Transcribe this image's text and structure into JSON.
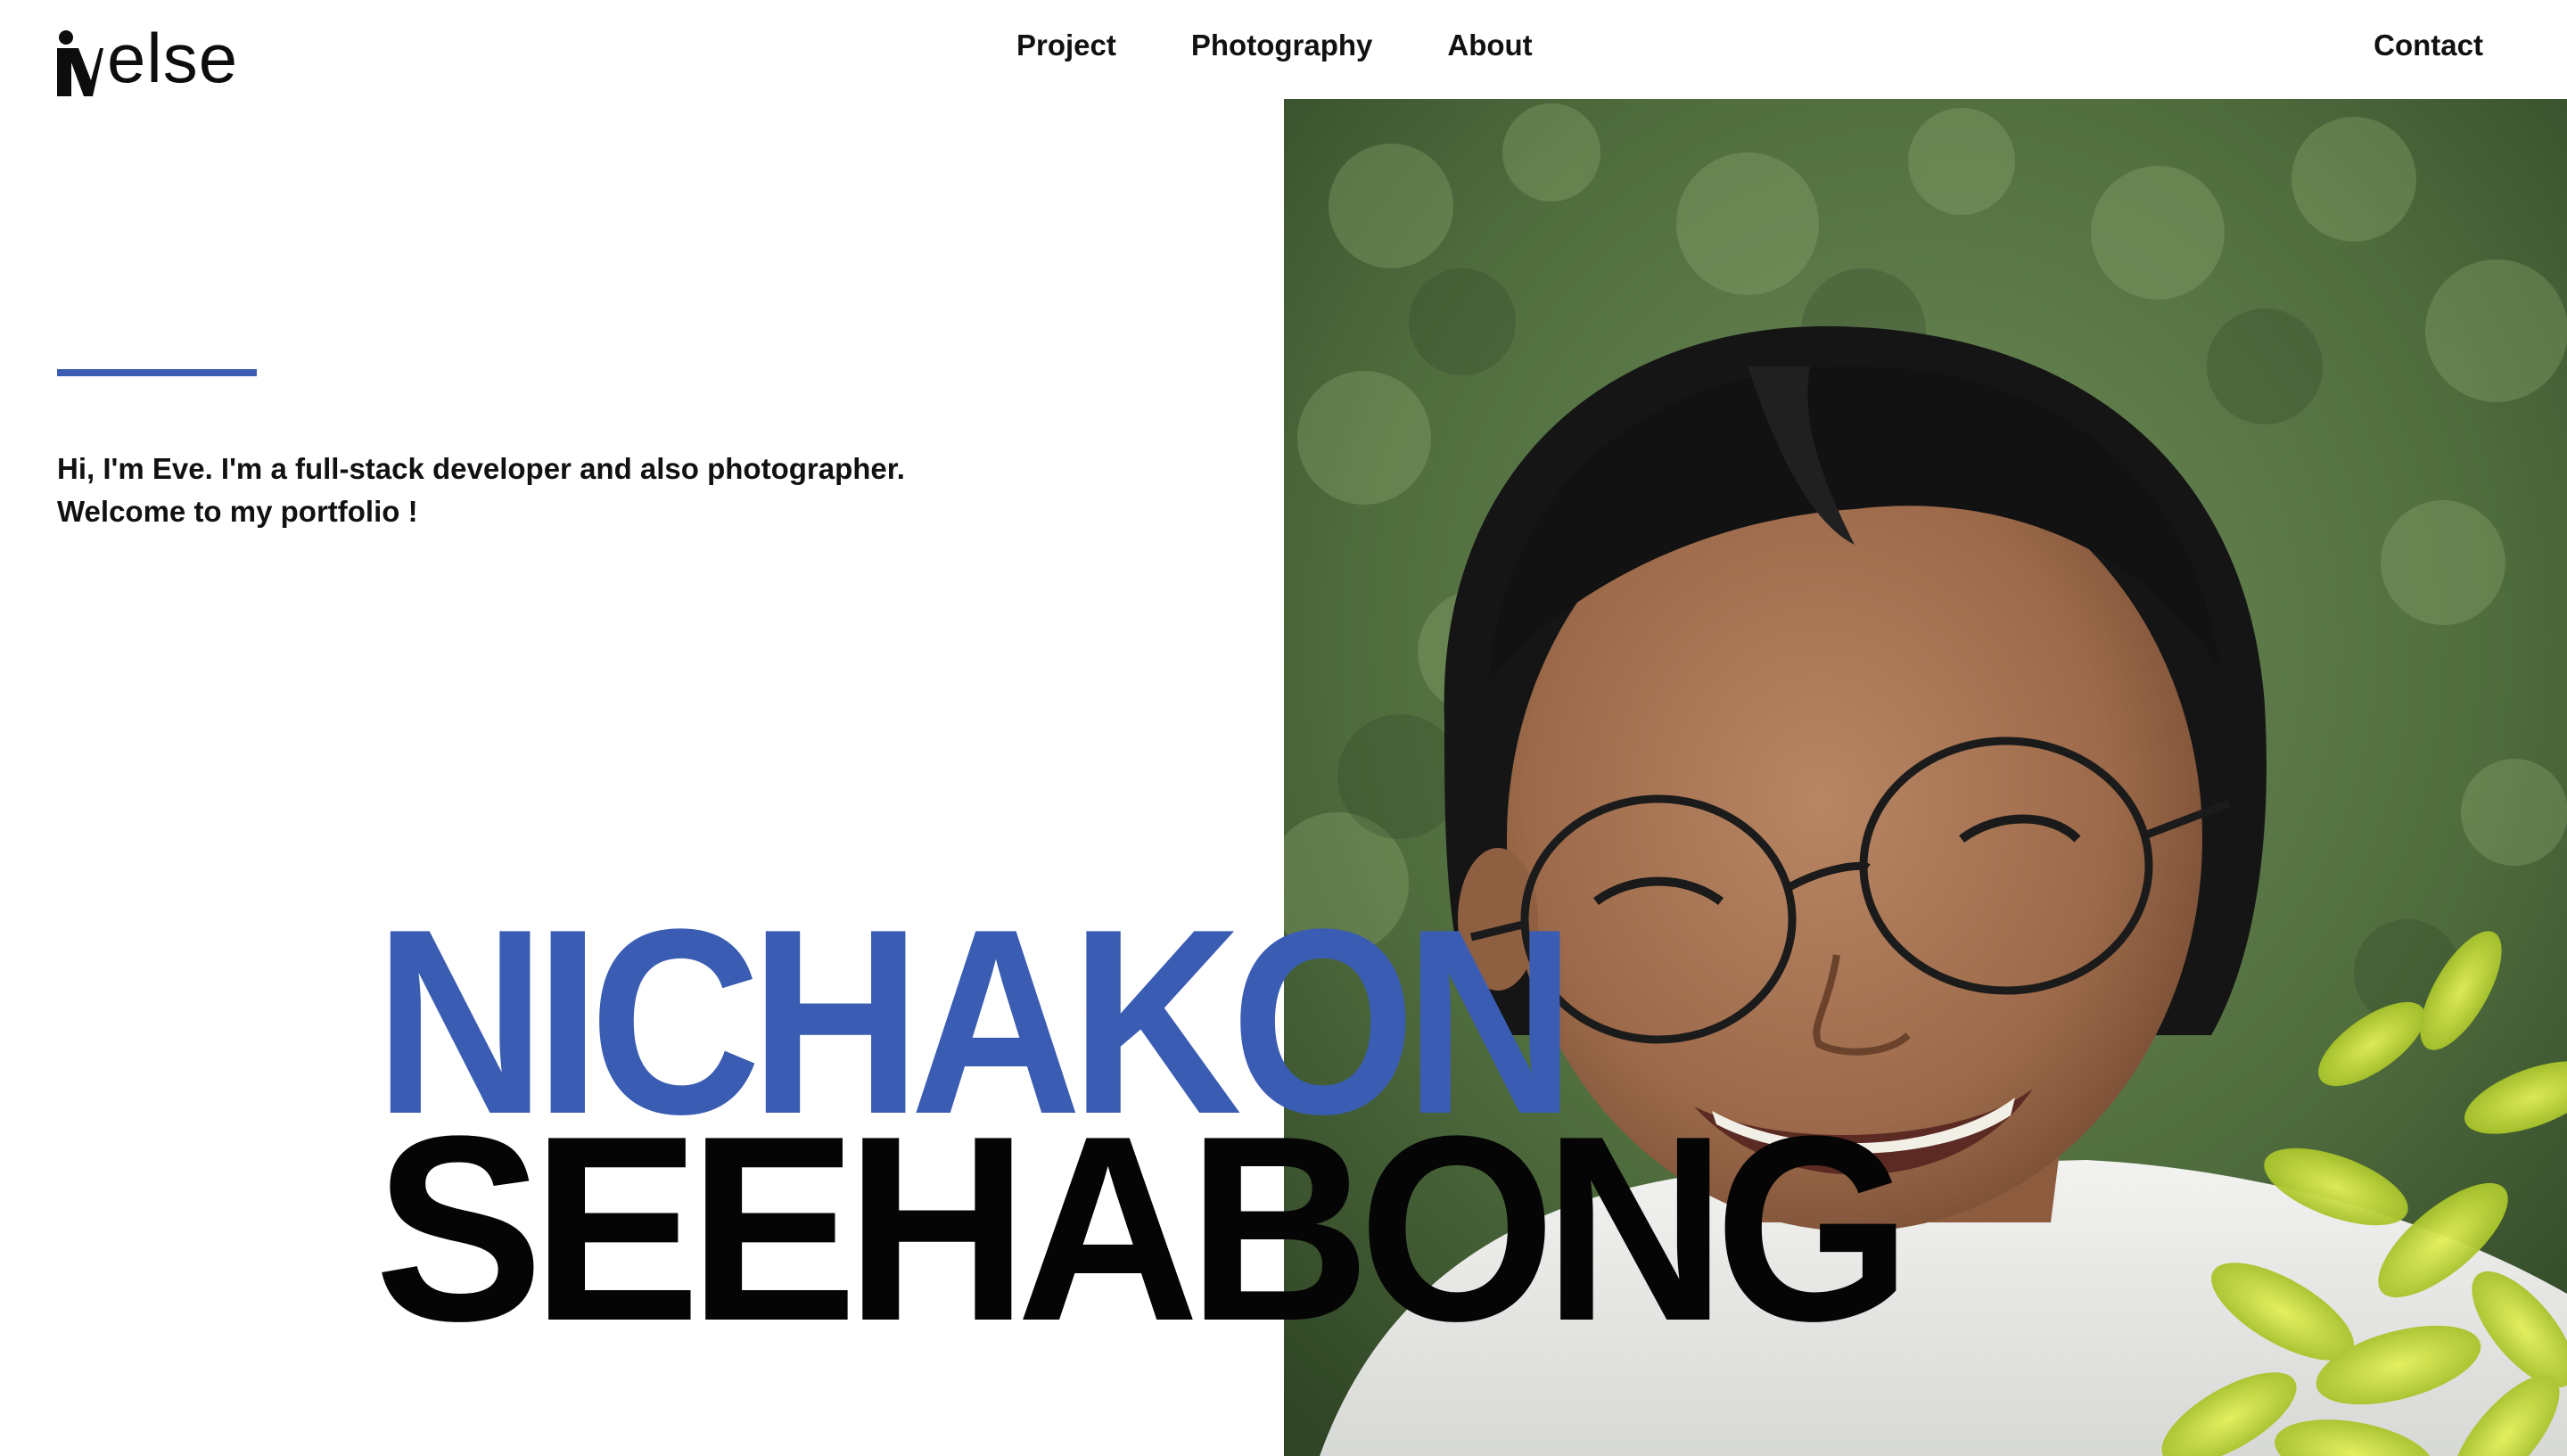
{
  "brand": {
    "logo_text": "else",
    "logo_icon": "person-v-logo-icon"
  },
  "nav": {
    "items": [
      {
        "label": "Project"
      },
      {
        "label": "Photography"
      },
      {
        "label": "About"
      }
    ],
    "contact_label": "Contact"
  },
  "hero": {
    "intro_line_1": "Hi, I'm Eve. I'm a full-stack developer and also photographer.",
    "intro_line_2": "Welcome to my portfolio !",
    "first_name": "NICHAKON",
    "last_name": "SEEHABONG",
    "portrait": "smiling-woman-with-glasses-portrait"
  },
  "colors": {
    "accent": "#3a5db3",
    "text": "#111111",
    "background": "#ffffff"
  }
}
